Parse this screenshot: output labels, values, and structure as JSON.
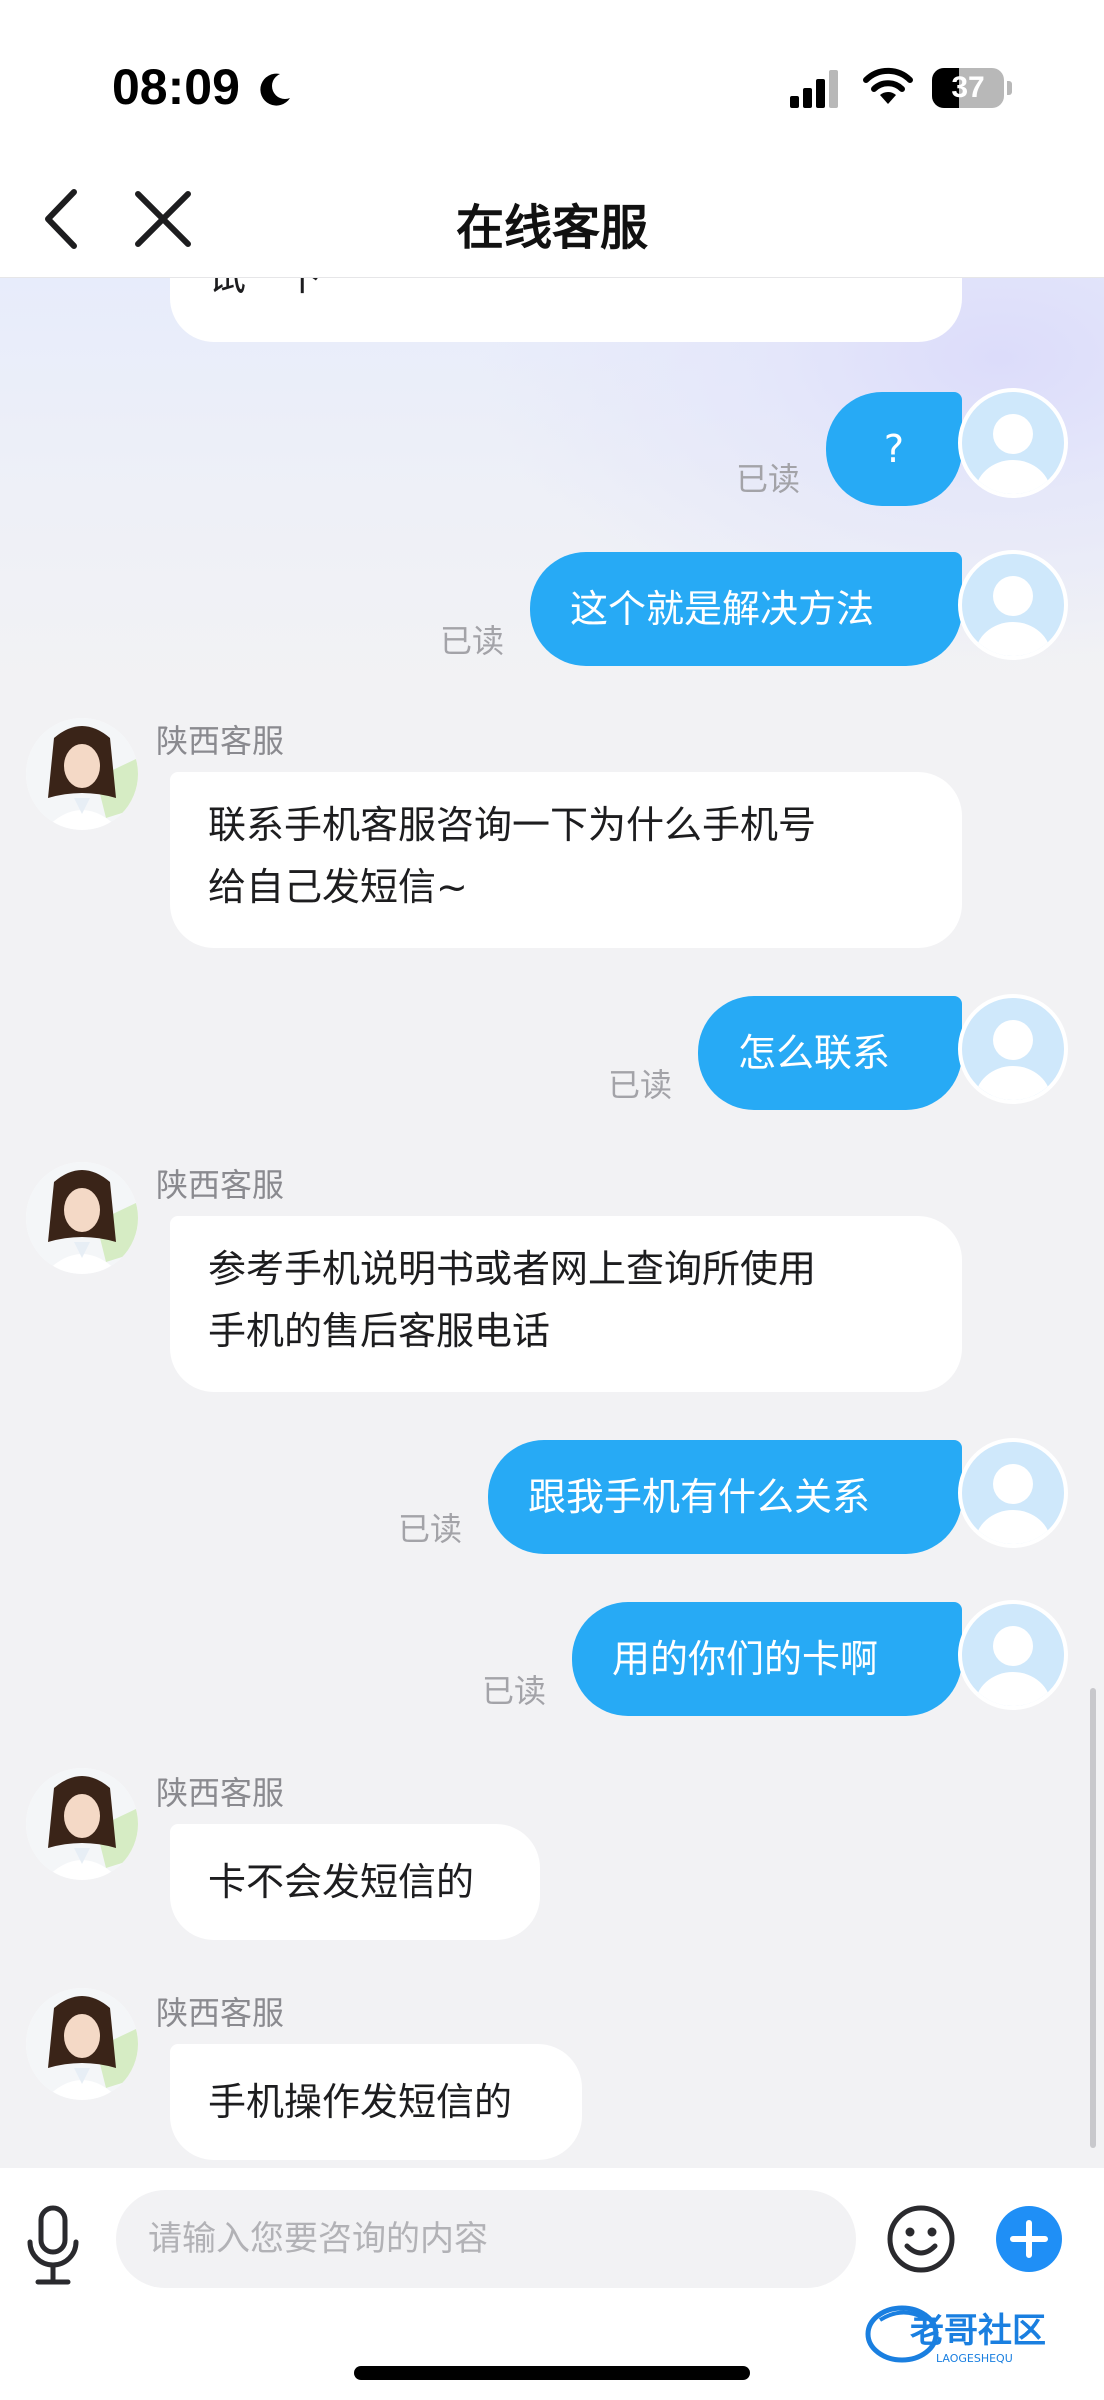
{
  "status_bar": {
    "time": "08:09",
    "battery_level": "37",
    "battery_fraction": 0.37
  },
  "nav": {
    "title": "在线客服"
  },
  "messages": [
    {
      "from": "agent",
      "text": "试一下"
    },
    {
      "from": "user",
      "text": "?",
      "read": "已读"
    },
    {
      "from": "user",
      "text": "这个就是解决方法",
      "read": "已读"
    },
    {
      "from": "agent",
      "sender": "陕西客服",
      "lines": [
        "联系手机客服咨询一下为什么手机号",
        "给自己发短信~"
      ]
    },
    {
      "from": "user",
      "text": "怎么联系",
      "read": "已读"
    },
    {
      "from": "agent",
      "sender": "陕西客服",
      "lines": [
        "参考手机说明书或者网上查询所使用",
        "手机的售后客服电话"
      ]
    },
    {
      "from": "user",
      "text": "跟我手机有什么关系",
      "read": "已读"
    },
    {
      "from": "user",
      "text": "用的你们的卡啊",
      "read": "已读"
    },
    {
      "from": "agent",
      "sender": "陕西客服",
      "text": "卡不会发短信的"
    },
    {
      "from": "agent",
      "sender": "陕西客服",
      "text": "手机操作发短信的"
    }
  ],
  "input": {
    "placeholder": "请输入您要咨询的内容"
  },
  "watermark": {
    "text": "老哥社区",
    "subtext": "LAOGESHEQU"
  },
  "icons": [
    "moon-icon",
    "signal-icon",
    "wifi-icon",
    "back-icon",
    "close-icon",
    "mic-icon",
    "emoji-icon",
    "plus-icon"
  ],
  "colors": {
    "user_bubble": "#27aaf5",
    "accent": "#1f8ff6"
  }
}
